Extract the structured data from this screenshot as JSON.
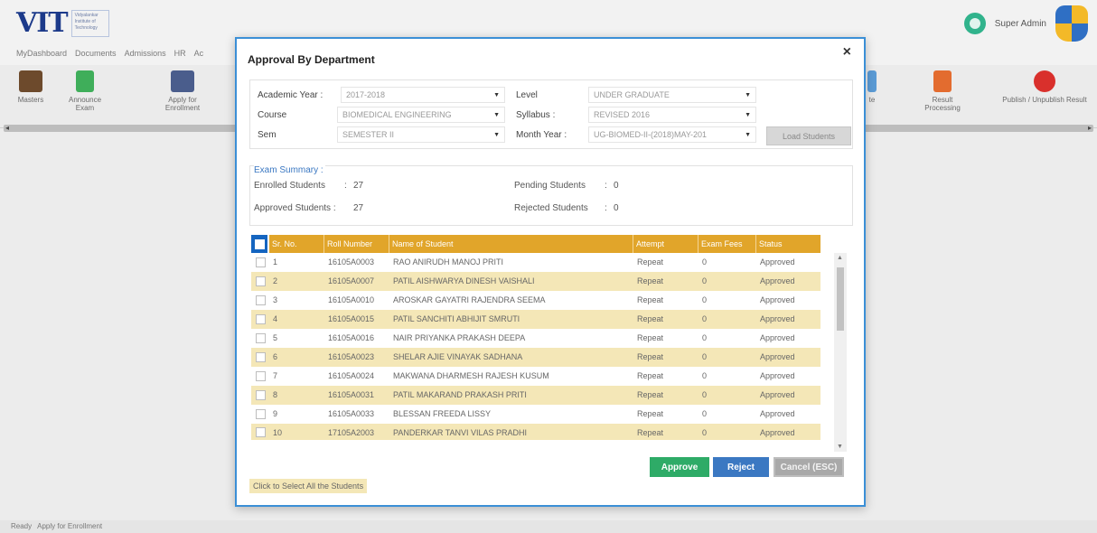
{
  "app": {
    "logo_text": "VIT",
    "logo_subtitle": "Vidyalankar Institute of Technology",
    "menu": [
      "MyDashboard",
      "Documents",
      "Admissions",
      "HR",
      "Ac"
    ],
    "user_name": "Super Admin",
    "ribbon": [
      {
        "label": "Masters",
        "icon": "masters-icon"
      },
      {
        "label": "Announce Exam",
        "icon": "megaphone-icon"
      },
      {
        "label": "Apply for Enrollment",
        "icon": "apply-icon"
      },
      {
        "label": "te",
        "icon": "doc-icon"
      },
      {
        "label": "Result Processing",
        "icon": "chart-icon"
      },
      {
        "label": "Publish / Unpublish Result",
        "icon": "publish-icon"
      }
    ],
    "status": [
      "Ready",
      "Apply for Enrollment"
    ]
  },
  "dialog": {
    "title": "Approval By Department",
    "close": "×",
    "filters": {
      "academic_year_label": "Academic Year :",
      "academic_year_value": "2017-2018",
      "course_label": "Course",
      "course_value": "BIOMEDICAL ENGINEERING",
      "sem_label": "Sem",
      "sem_value": "SEMESTER II",
      "level_label": "Level",
      "level_value": "UNDER GRADUATE",
      "syllabus_label": "Syllabus :",
      "syllabus_value": "REVISED 2016",
      "month_year_label": "Month Year :",
      "month_year_value": "UG-BIOMED-II-(2018)MAY-201",
      "colon": ":",
      "load_button": "Load Students"
    },
    "summary": {
      "title": "Exam Summary :",
      "enrolled_label": "Enrolled Students",
      "enrolled_value": "27",
      "approved_label": "Approved Students :",
      "approved_value": "27",
      "pending_label": "Pending Students",
      "pending_value": "0",
      "rejected_label": "Rejected Students",
      "rejected_value": "0",
      "colon": ":"
    },
    "grid": {
      "columns": [
        "Sr. No.",
        "Roll Number",
        "Name of Student",
        "Attempt",
        "Exam Fees",
        "Status"
      ],
      "rows": [
        {
          "sr": "1",
          "roll": "16105A0003",
          "name": "RAO ANIRUDH MANOJ PRITI",
          "attempt": "Repeat",
          "fees": "0",
          "status": "Approved"
        },
        {
          "sr": "2",
          "roll": "16105A0007",
          "name": "PATIL AISHWARYA DINESH VAISHALI",
          "attempt": "Repeat",
          "fees": "0",
          "status": "Approved"
        },
        {
          "sr": "3",
          "roll": "16105A0010",
          "name": "AROSKAR GAYATRI RAJENDRA SEEMA",
          "attempt": "Repeat",
          "fees": "0",
          "status": "Approved"
        },
        {
          "sr": "4",
          "roll": "16105A0015",
          "name": "PATIL SANCHITI ABHIJIT SMRUTI",
          "attempt": "Repeat",
          "fees": "0",
          "status": "Approved"
        },
        {
          "sr": "5",
          "roll": "16105A0016",
          "name": "NAIR PRIYANKA PRAKASH DEEPA",
          "attempt": "Repeat",
          "fees": "0",
          "status": "Approved"
        },
        {
          "sr": "6",
          "roll": "16105A0023",
          "name": "SHELAR AJIE VINAYAK SADHANA",
          "attempt": "Repeat",
          "fees": "0",
          "status": "Approved"
        },
        {
          "sr": "7",
          "roll": "16105A0024",
          "name": "MAKWANA DHARMESH RAJESH KUSUM",
          "attempt": "Repeat",
          "fees": "0",
          "status": "Approved"
        },
        {
          "sr": "8",
          "roll": "16105A0031",
          "name": "PATIL MAKARAND PRAKASH PRITI",
          "attempt": "Repeat",
          "fees": "0",
          "status": "Approved"
        },
        {
          "sr": "9",
          "roll": "16105A0033",
          "name": "BLESSAN FREEDA LISSY",
          "attempt": "Repeat",
          "fees": "0",
          "status": "Approved"
        },
        {
          "sr": "10",
          "roll": "17105A2003",
          "name": "PANDERKAR TANVI VILAS PRADHI",
          "attempt": "Repeat",
          "fees": "0",
          "status": "Approved"
        }
      ]
    },
    "buttons": {
      "approve": "Approve",
      "reject": "Reject",
      "cancel": "Cancel (ESC)"
    },
    "select_all_hint": "Click to Select All the Students"
  },
  "colors": {
    "header_gold": "#e1a52a",
    "row_alt": "#f4e7b7",
    "approve_green": "#2eab67",
    "reject_blue": "#3b78c2",
    "dialog_border": "#3b8fd6"
  }
}
